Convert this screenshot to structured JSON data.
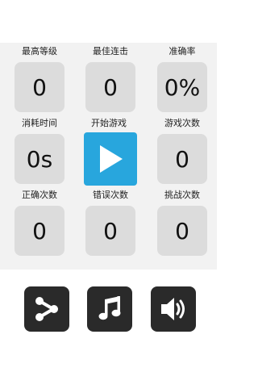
{
  "stats": {
    "max_level": {
      "label": "最高等级",
      "value": "0"
    },
    "best_combo": {
      "label": "最佳连击",
      "value": "0"
    },
    "accuracy": {
      "label": "准确率",
      "value": "0%"
    },
    "time_spent": {
      "label": "消耗时间",
      "value": "0s"
    },
    "start_game": {
      "label": "开始游戏"
    },
    "game_count": {
      "label": "游戏次数",
      "value": "0"
    },
    "correct": {
      "label": "正确次数",
      "value": "0"
    },
    "wrong": {
      "label": "错误次数",
      "value": "0"
    },
    "challenges": {
      "label": "挑战次数",
      "value": "0"
    }
  },
  "toolbar": {
    "share_icon": "share-icon",
    "music_icon": "music-icon",
    "sound_icon": "speaker-icon"
  },
  "colors": {
    "accent": "#28a6dd",
    "tile": "#dcdcdc",
    "panel": "#f2f2f2",
    "button_dark": "#2a2a2a"
  }
}
